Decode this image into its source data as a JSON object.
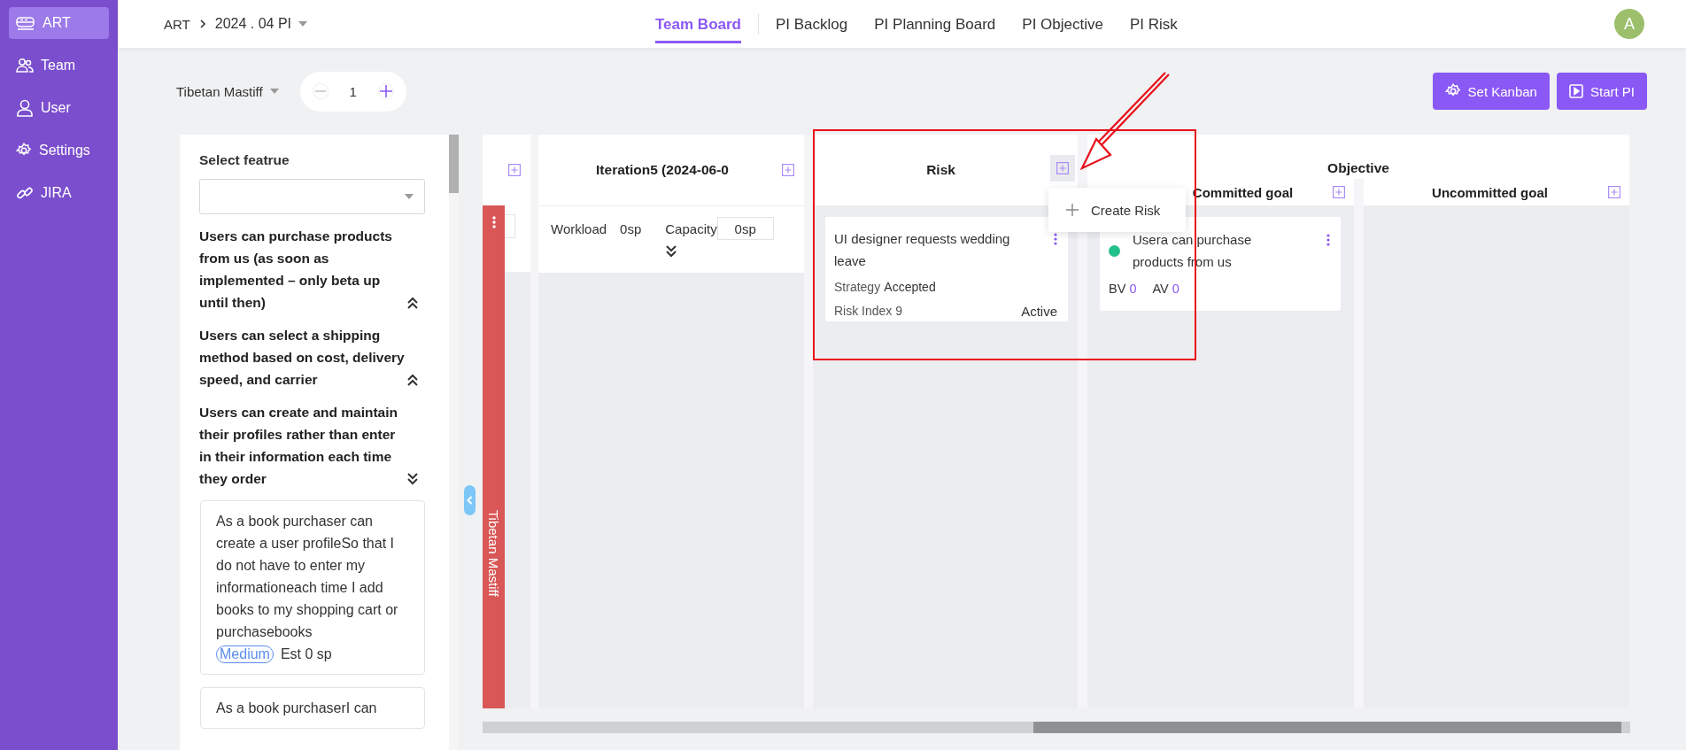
{
  "sidebar": {
    "items": [
      {
        "label": "ART",
        "selected": true
      },
      {
        "label": "Team",
        "selected": false
      },
      {
        "label": "User",
        "selected": false
      },
      {
        "label": "Settings",
        "selected": false
      },
      {
        "label": "JIRA",
        "selected": false
      }
    ]
  },
  "breadcrumb": {
    "root": "ART",
    "current": "2024 . 04 PI"
  },
  "tabs": [
    {
      "label": "Team Board",
      "selected": true
    },
    {
      "label": "PI Backlog",
      "selected": false
    },
    {
      "label": "PI Planning Board",
      "selected": false
    },
    {
      "label": "PI Objective",
      "selected": false
    },
    {
      "label": "PI Risk",
      "selected": false
    }
  ],
  "avatar": {
    "initial": "A"
  },
  "toolbar": {
    "team": "Tibetan Mastiff",
    "stepper_value": "1",
    "buttons": [
      {
        "label": "Set Kanban"
      },
      {
        "label": "Start PI"
      }
    ]
  },
  "feature_panel": {
    "title": "Select featrue",
    "features": [
      {
        "text": "Users can purchase products from us (as soon as implemented – only beta up until then)",
        "expanded": true
      },
      {
        "text": "Users can select a shipping method based on cost, delivery speed, and carrier",
        "expanded": true
      },
      {
        "text": "Users can create and maintain their profiles rather than enter in their information each time they order",
        "expanded": false
      }
    ],
    "stories": [
      {
        "text": "As a book purchaser can create a user profileSo that I do not have to enter my informationeach time I add books to my shopping cart or purchasebooks",
        "priority": "Medium",
        "estimate": "Est 0 sp"
      },
      {
        "text": "As a book purchaserI can"
      }
    ]
  },
  "board": {
    "swimlane": "Tibetan Mastiff",
    "iteration": {
      "title": "Iteration5 (2024-06-0",
      "workload_label": "Workload",
      "workload": "0sp",
      "capacity_label": "Capacity",
      "capacity": "0sp"
    },
    "risk": {
      "title": "Risk",
      "cards": [
        {
          "title": "UI designer requests wedding leave",
          "strategy_label": "Strategy",
          "strategy": "Accepted",
          "index_label": "Risk Index 9",
          "status": "Active"
        }
      ]
    },
    "objective": {
      "title": "Objective",
      "columns": [
        {
          "title": "Committed goal",
          "cards": [
            {
              "title": "Usera can purchase products from us",
              "color": "#22c08b",
              "bv_label": "BV",
              "bv": "0",
              "av_label": "AV",
              "av": "0"
            }
          ]
        },
        {
          "title": "Uncommitted goal"
        }
      ]
    }
  },
  "menu": {
    "items": [
      "Create Risk"
    ]
  }
}
